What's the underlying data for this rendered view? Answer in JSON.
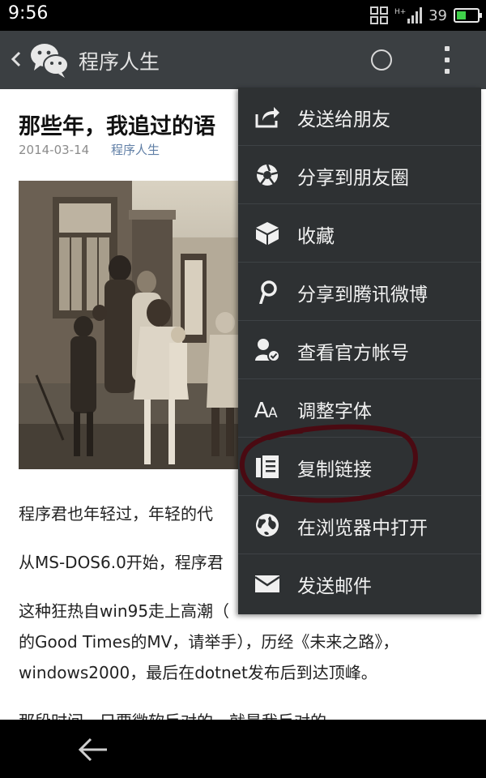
{
  "status_bar": {
    "time": "9:56",
    "network": "H+",
    "battery_level": "39",
    "battery_fraction": 0.39
  },
  "title_bar": {
    "title": "程序人生"
  },
  "article": {
    "title": "那些年，我追过的语",
    "date": "2014-03-14",
    "author": "程序人生",
    "paragraphs": [
      "程序君也年轻过，年轻的代",
      "从MS-DOS6.0开始，程序君",
      "这种狂热自win95走上高潮（",
      "的Good Times的MV，请举手），历经《未来之路》，",
      "windows2000，最后在dotnet发布后到达顶峰。",
      "那段时间，只要微软反对的，就是我反对的"
    ]
  },
  "menu": {
    "items": [
      {
        "label": "发送给朋友",
        "icon": "share-arrow-icon"
      },
      {
        "label": "分享到朋友圈",
        "icon": "aperture-icon"
      },
      {
        "label": "收藏",
        "icon": "cube-icon"
      },
      {
        "label": "分享到腾讯微博",
        "icon": "weibo-icon"
      },
      {
        "label": "查看官方帐号",
        "icon": "verified-user-icon"
      },
      {
        "label": "调整字体",
        "icon": "font-size-icon"
      },
      {
        "label": "复制链接",
        "icon": "copy-icon"
      },
      {
        "label": "在浏览器中打开",
        "icon": "globe-icon"
      },
      {
        "label": "发送邮件",
        "icon": "mail-icon"
      }
    ],
    "highlighted_item": "复制链接"
  },
  "colors": {
    "title_bar_bg": "#3b3f42",
    "menu_bg": "#2e3133",
    "author_link": "#607fa6",
    "battery_green": "#3fd14a",
    "highlight_ring": "#4a0a12"
  }
}
